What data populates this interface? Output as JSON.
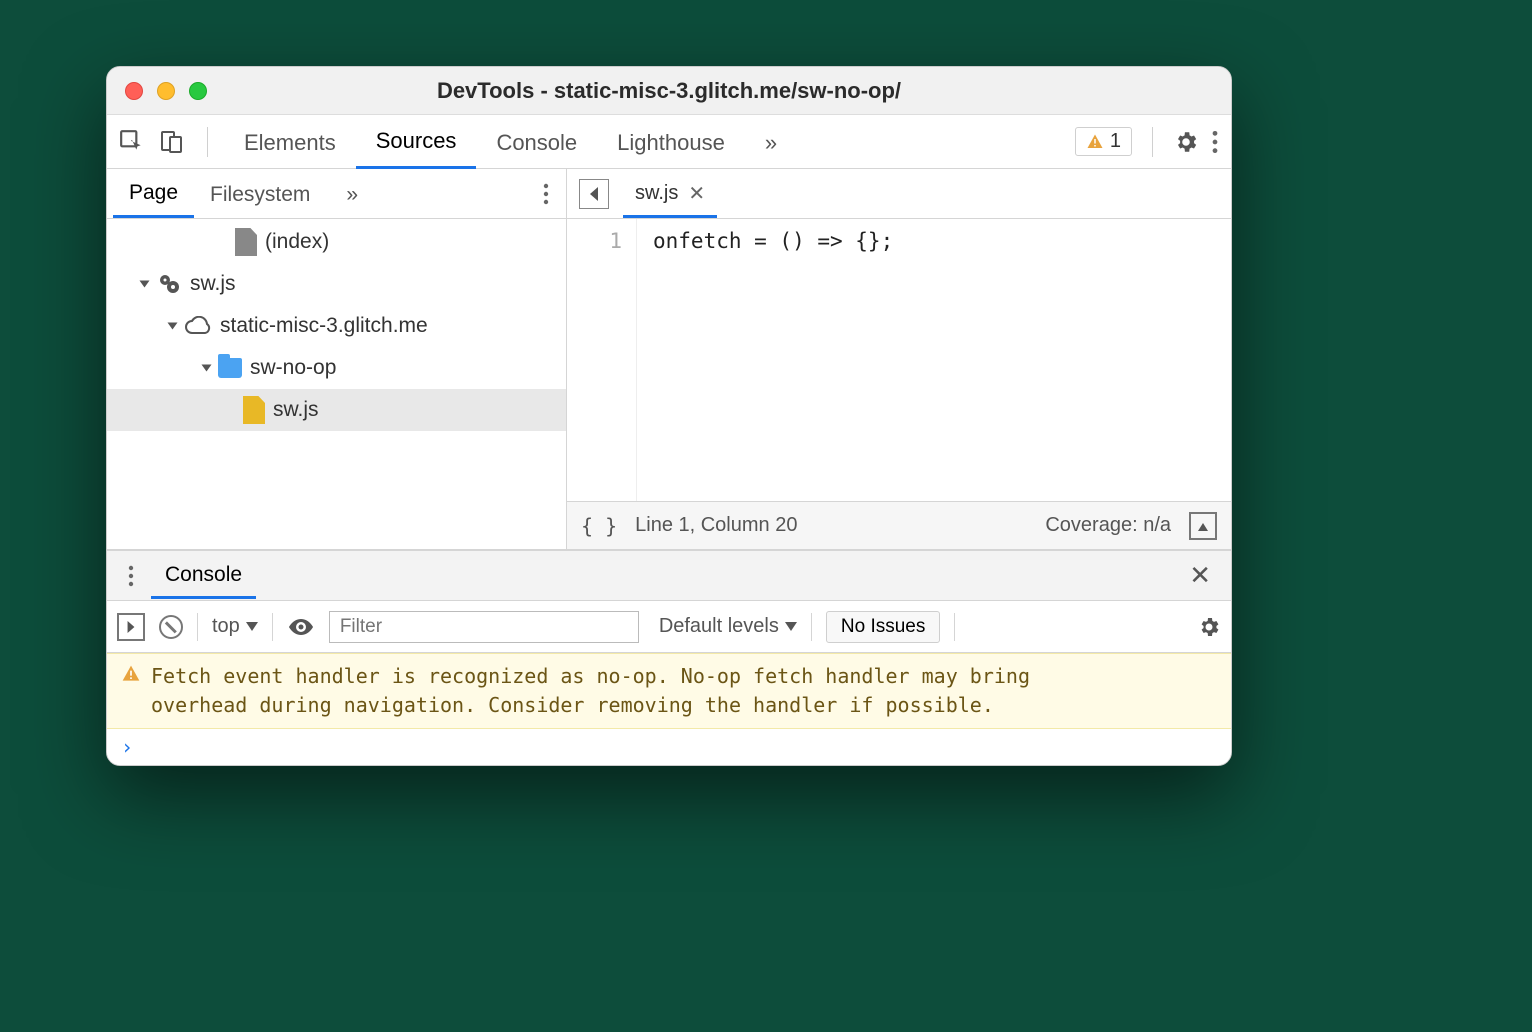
{
  "window": {
    "title": "DevTools - static-misc-3.glitch.me/sw-no-op/"
  },
  "toolbar": {
    "tabs": [
      "Elements",
      "Sources",
      "Console",
      "Lighthouse"
    ],
    "active_tab": "Sources",
    "more_label": "»",
    "warning_count": "1"
  },
  "sources": {
    "subtabs": [
      "Page",
      "Filesystem"
    ],
    "active_subtab": "Page",
    "more_label": "»",
    "tree": {
      "index_label": "(index)",
      "sw_root": "sw.js",
      "domain": "static-misc-3.glitch.me",
      "folder": "sw-no-op",
      "file": "sw.js"
    }
  },
  "editor": {
    "open_file": "sw.js",
    "line_number": "1",
    "code_line_1": "onfetch = () => {};",
    "status_position": "Line 1, Column 20",
    "status_coverage": "Coverage: n/a",
    "format_label": "{ }"
  },
  "drawer": {
    "tab": "Console"
  },
  "console": {
    "context": "top",
    "filter_placeholder": "Filter",
    "levels_label": "Default levels",
    "issues_label": "No Issues",
    "warning_text": "Fetch event handler is recognized as no-op. No-op fetch handler may bring overhead during navigation. Consider removing the handler if possible.",
    "prompt": "›"
  }
}
